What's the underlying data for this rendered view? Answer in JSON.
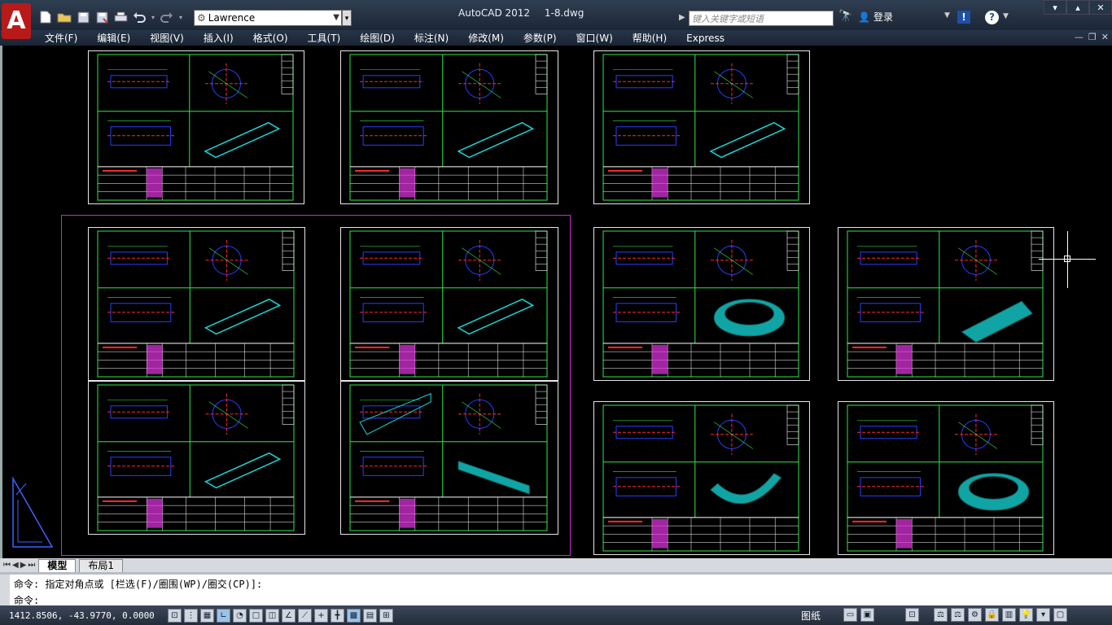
{
  "app": {
    "logo": "A",
    "title": "AutoCAD 2012",
    "filename": "1-8.dwg"
  },
  "workspace": {
    "value": "Lawrence"
  },
  "search": {
    "placeholder": "键入关键字或短语"
  },
  "login": {
    "label": "登录"
  },
  "quick_access": [
    "new-icon",
    "open-icon",
    "save-icon",
    "save-as-icon",
    "plot-icon",
    "undo-icon",
    "redo-icon"
  ],
  "menu": [
    "文件(F)",
    "编辑(E)",
    "视图(V)",
    "插入(I)",
    "格式(O)",
    "工具(T)",
    "绘图(D)",
    "标注(N)",
    "修改(M)",
    "参数(P)",
    "窗口(W)",
    "帮助(H)",
    "Express"
  ],
  "tabs": {
    "model": "模型",
    "layout": "布局1"
  },
  "command": {
    "history": "命令: 指定对角点或 [栏选(F)/圈围(WP)/圈交(CP)]:",
    "prompt": "命令:"
  },
  "status": {
    "coords": "1412.8506, -43.9770, 0.0000",
    "paper": "图纸"
  },
  "colors": {
    "titlebar": "#1c2736",
    "drawing_green": "#2ee84a",
    "drawing_cyan": "#18d6d6",
    "drawing_blue": "#2a3dff",
    "drawing_red": "#ff2a2a",
    "drawing_magenta": "#e635e6",
    "selection": "#c829c8"
  }
}
